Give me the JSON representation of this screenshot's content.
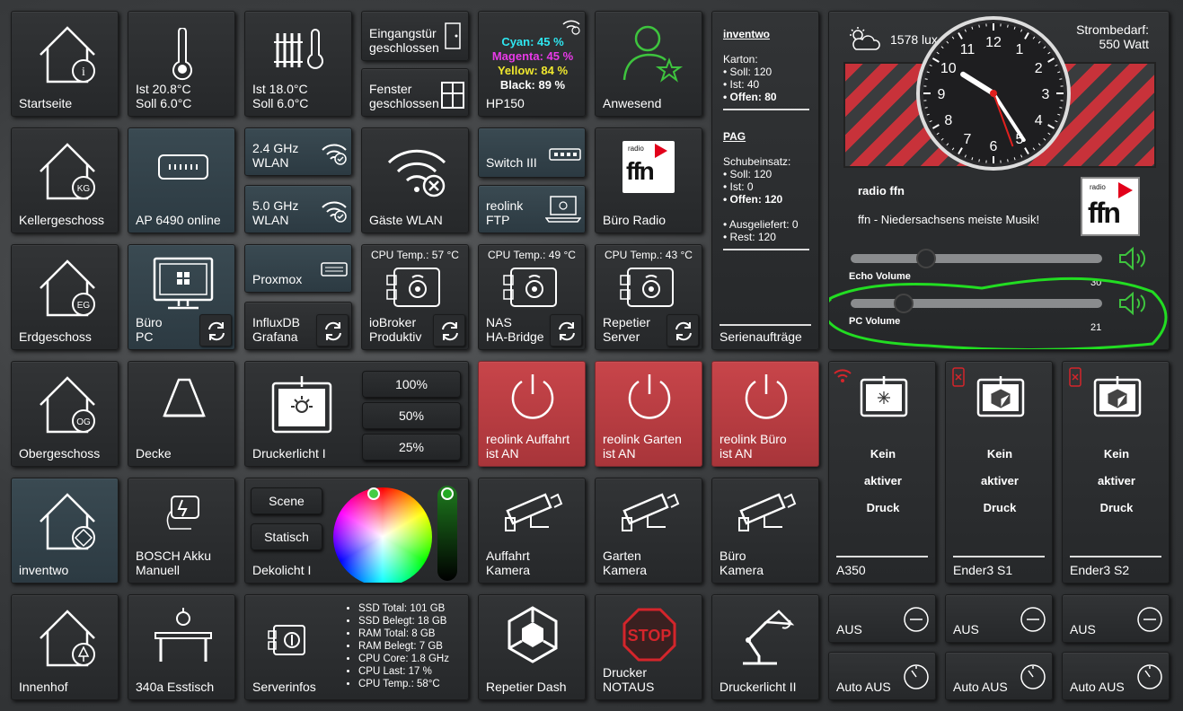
{
  "tiles": {
    "startseite": "Startseite",
    "keller": "Kellergeschoss",
    "erd": "Erdgeschoss",
    "ober": "Obergeschoss",
    "inventwo": "inventwo",
    "innenhof": "Innenhof",
    "temp1": "Ist 20.8°C\nSoll 6.0°C",
    "temp2": "Ist 18.0°C\nSoll 6.0°C",
    "ap": "AP 6490 online",
    "wlan24": "2.4 GHz\nWLAN",
    "wlan50": "5.0 GHz\nWLAN",
    "buero_pc": "Büro\nPC",
    "proxmox": "Proxmox",
    "influx": "InfluxDB\nGrafana",
    "decke": "Decke",
    "bosch": "BOSCH Akku\nManuell",
    "esstisch": "340a Esstisch",
    "door": "Eingangstür\ngeschlossen",
    "window": "Fenster\ngeschlossen",
    "gaeste": "Gäste WLAN",
    "iobroker": "ioBroker\nProduktiv",
    "nas": "NAS\nHA-Bridge",
    "repetier_server": "Repetier\nServer",
    "druckerlicht1": "Druckerlicht I",
    "dekolicht": "Dekolicht I",
    "serverinfos": "Serverinfos",
    "hp150": "HP150",
    "switch3": "Switch III",
    "reolink_ftp": "reolink\nFTP",
    "anwesend": "Anwesend",
    "buero_radio": "Büro Radio",
    "reo_auf": "reolink Auffahrt\nist AN",
    "reo_gar": "reolink Garten\nist AN",
    "reo_bue": "reolink Büro\nist AN",
    "cam_auf": "Auffahrt\nKamera",
    "cam_gar": "Garten\nKamera",
    "cam_bue": "Büro\nKamera",
    "repetier_dash": "Repetier Dash",
    "notaus": "Drucker\nNOTAUS",
    "druckerlicht2": "Druckerlicht II",
    "serienauftraege": "Serienaufträge"
  },
  "cpu": {
    "io": "CPU Temp.: 57 °C",
    "nas": "CPU Temp.: 49 °C",
    "rep": "CPU Temp.: 43 °C"
  },
  "ink": {
    "cyan": "Cyan: 45 %",
    "magenta": "Magenta: 45 %",
    "yellow": "Yellow: 84 %",
    "black": "Black: 89 %"
  },
  "dimmer": {
    "p100": "100%",
    "p50": "50%",
    "p25": "25%"
  },
  "deko": {
    "scene": "Scene",
    "statisch": "Statisch"
  },
  "server": [
    "SSD Total: 101 GB",
    "SSD Belegt: 18 GB",
    "RAM Total: 8 GB",
    "RAM Belegt: 7 GB",
    "CPU Core: 1.8 GHz",
    "CPU Last: 17 %",
    "CPU Temp.: 58°C"
  ],
  "orders": {
    "inventwo_title": "inventwo",
    "karton": "Karton:",
    "soll1": "• Soll: 120",
    "ist1": "• Ist: 40",
    "offen1": "• Offen: 80",
    "pag_title": "PAG",
    "schub": "Schubeinsatz:",
    "soll2": "• Soll: 120",
    "ist2": "• Ist: 0",
    "offen2": "• Offen: 120",
    "ausgeliefert": "• Ausgeliefert: 0",
    "rest": "• Rest: 120"
  },
  "radio": {
    "lux": "1578 lux",
    "strom": "Strombedarf:\n550 Watt",
    "station": "radio ffn",
    "slogan": "ffn - Niedersachsens meiste Musik!",
    "echo_label": "Echo Volume",
    "echo_value": "30",
    "pc_label": "PC Volume",
    "pc_value": "21",
    "echo_level": 0.3,
    "pc_level": 0.21
  },
  "printers": {
    "kein1": "Kein",
    "aktiver": "aktiver",
    "druck": "Druck",
    "a350": "A350",
    "ender1": "Ender3 S1",
    "ender2": "Ender3 S2",
    "aus": "AUS",
    "autoaus": "Auto AUS"
  },
  "clock": {
    "numbers": [
      "12",
      "1",
      "2",
      "3",
      "4",
      "5",
      "6",
      "7",
      "8",
      "9",
      "10",
      "11"
    ]
  },
  "colors": {
    "blue_tile": "#3a4a52",
    "red_tile": "#c8454a",
    "green_highlight": "#22dd22"
  }
}
